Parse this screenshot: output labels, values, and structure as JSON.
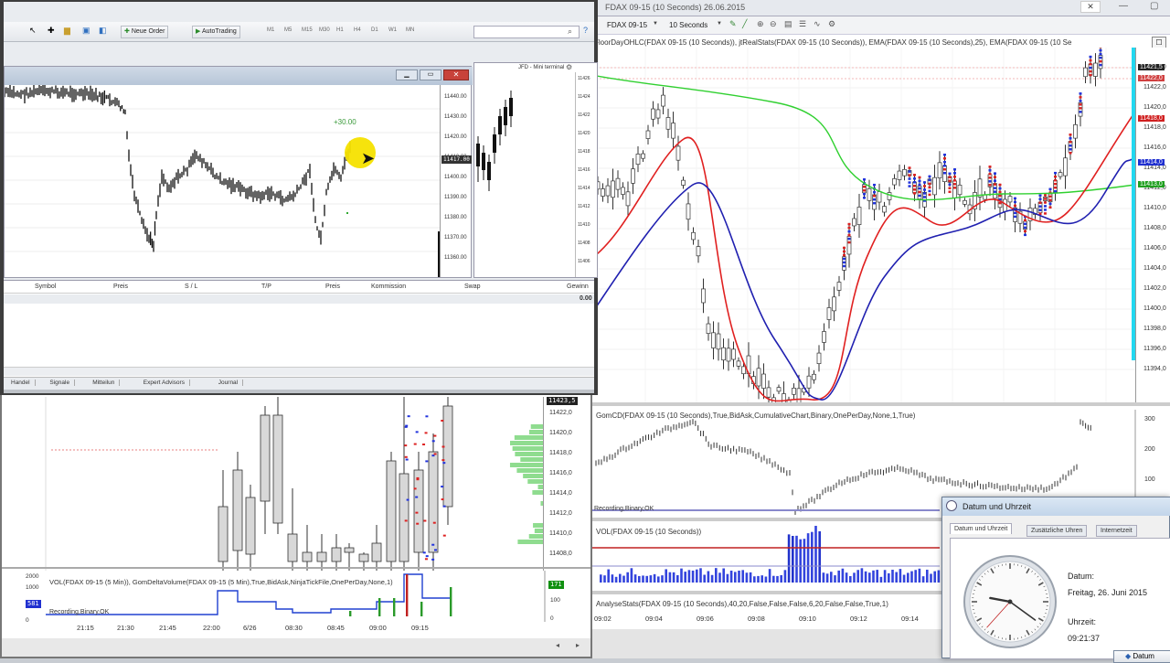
{
  "mt_toolbar": {
    "new_order": "Neue Order",
    "autotrading": "AutoTrading",
    "timeframes": [
      "M1",
      "M5",
      "M15",
      "M30",
      "H1",
      "H4",
      "D1",
      "W1",
      "MN"
    ]
  },
  "mt_chart": {
    "annotation": "+30.00",
    "price_labels": [
      "11440.00",
      "11430.00",
      "11420.00",
      "11410.00",
      "11400.00",
      "11390.00",
      "11380.00",
      "11370.00",
      "11360.00"
    ],
    "current_price": "11417.00",
    "side_title": "JFD - Mini terminal",
    "side_prices": [
      "11426",
      "11424",
      "11422",
      "11420",
      "11418",
      "11416",
      "11414",
      "11412",
      "11410",
      "11408",
      "11406"
    ]
  },
  "mt_terminal": {
    "columns": [
      "Symbol",
      "Preis",
      "S / L",
      "T/P",
      "Preis",
      "Kommission",
      "Swap",
      "Gewinn"
    ],
    "balance_value": "0.00",
    "tabs": [
      "Handel",
      "Signale",
      "Mitteilun",
      "Expert Advisors",
      "Journal"
    ]
  },
  "nt_main": {
    "title": "FDAX 09-15 (10 Seconds)  26.06.2015",
    "instrument": "FDAX 09-15",
    "interval": "10 Seconds",
    "indicators_line": "FloorDayOHLC(FDAX 09-15 (10 Seconds)), jtRealStats(FDAX 09-15 (10 Seconds)), EMA(FDAX 09-15 (10 Seconds),25), EMA(FDAX 09-15 (10 Se",
    "price_axis": [
      "11424,0",
      "11422,0",
      "11420,0",
      "11418,0",
      "11416,0",
      "11414,0",
      "11412,0",
      "11410,0",
      "11408,0",
      "11406,0",
      "11404,0",
      "11402,0",
      "11400,0",
      "11398,0",
      "11396,0",
      "11394,0"
    ],
    "tags": [
      {
        "text": "11421,5",
        "color": "#222222"
      },
      {
        "text": "11422,0",
        "color": "#d04040"
      },
      {
        "text": "11418,0",
        "color": "#d02020"
      },
      {
        "text": "11414,0",
        "color": "#2030d0"
      },
      {
        "text": "11413,0",
        "color": "#20a020"
      }
    ],
    "cd_label": "GomCD(FDAX 09-15 (10 Seconds),True,BidAsk,CumulativeChart,Binary,OnePerDay,None,1,True)",
    "cd_axis": [
      "300",
      "200",
      "100"
    ],
    "cd_status": "Recording,Binary,OK",
    "vol_label": "VOL(FDAX 09-15 (10 Seconds))",
    "time_labels": [
      "09:02",
      "09:04",
      "09:06",
      "09:08",
      "09:10",
      "09:12",
      "09:14"
    ],
    "bottom_label": "AnalyseStats(FDAX 09-15 (10 Seconds),40,20,False,False,False,6,20,False,False,True,1)"
  },
  "nt_bottom": {
    "price_axis": [
      "11422,0",
      "11420,0",
      "11418,0",
      "11416,0",
      "11414,0",
      "11412,0",
      "11410,0",
      "11408,0"
    ],
    "top_tag": "11423,5",
    "vol_label": "VOL(FDAX 09-15 (5 Min)),  GomDeltaVolume(FDAX 09-15 (5 Min),True,BidAsk,NinjaTickFile,OnePerDay,None,1)",
    "vol_axis": [
      "2000",
      "1000",
      "0",
      "100",
      "0"
    ],
    "vol_tag_left": "581",
    "vol_tag_right": "171",
    "status": "Recording,Binary,OK",
    "time_labels": [
      "21:15",
      "21:30",
      "21:45",
      "22:00",
      "6/26",
      "08:30",
      "08:45",
      "09:00",
      "09:15"
    ]
  },
  "datetime_dialog": {
    "title": "Datum und Uhrzeit",
    "tabs": [
      "Datum und Uhrzeit",
      "Zusätzliche Uhren",
      "Internetzeit"
    ],
    "date_label": "Datum:",
    "date_value": "Freitag, 26. Juni 2015",
    "time_label": "Uhrzeit:",
    "time_value": "09:21:37",
    "change_button": "Datum"
  },
  "colors": {
    "ema_fast": "#e02020",
    "ema_slow": "#2020b0",
    "floor": "#30d030",
    "cyan": "#22d8f0"
  }
}
